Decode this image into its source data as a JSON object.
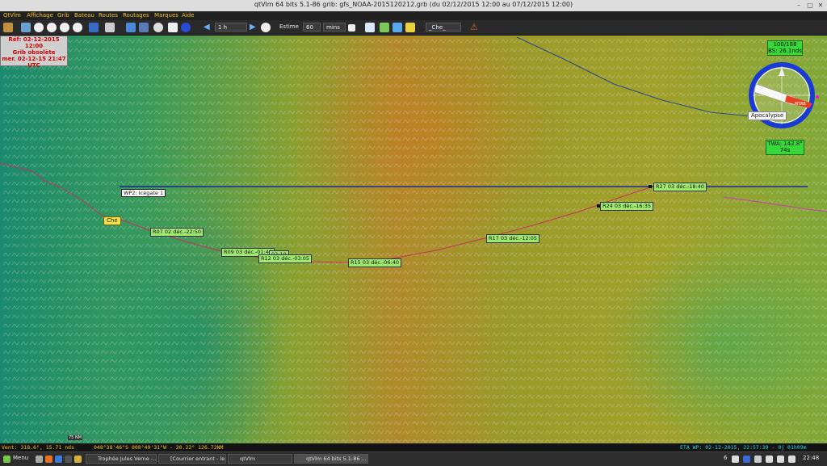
{
  "window": {
    "title": "qtVlm 64 bits 5.1-86 grib: gfs_NOAA-2015120212.grb (du 02/12/2015 12:00 au 07/12/2015 12:00)"
  },
  "menu": [
    "QtVlm",
    "Affichage",
    "Grib",
    "Bateau",
    "Routes",
    "Routages",
    "Marques",
    "Aide"
  ],
  "toolbar": {
    "time_step": "1 h",
    "estime_label": "Estime",
    "estime_value": "60",
    "estime_unit": "mins",
    "boat_select": "_Che_"
  },
  "grib_info": {
    "line1": "Réf: 02-12-2015 12:00",
    "line2": "Grib obsolète",
    "line3": "mer. 02-12-15 21:47",
    "line4": "UTC"
  },
  "waypoint": {
    "label": "WP2: Icegate 1"
  },
  "boat": {
    "label": "Che"
  },
  "route_labels": [
    "R07 02 déc.-22:50",
    "R09 03 déc.-01:40",
    "R12 03 déc.-03:05",
    "R15 03 déc.-06:40",
    "R17 03 déc.-12:05",
    "R24 03 déc.-16:35",
    "R27 03 déc.-18:40"
  ],
  "route_overlap_fragment": "02:10",
  "compass": {
    "count": "100/188",
    "bs": "BS: 26.1nds",
    "route_name": "Apocalypse",
    "vmg_tag": "MTAB",
    "twa": "TWA: 142.8°",
    "twa_sub": "74s"
  },
  "status": {
    "wind": "Vent: 318.6°,  15.71 nds",
    "position": "048°38'46\"S  008°49'31\"W - 20.22°  126.72NM",
    "eta": "ETA WP: 02-12-2015, 22:57:39 - 0j 01h09m"
  },
  "taskbar": {
    "menu": "Menu",
    "tasks": [
      "Trophée Jules Verne -...",
      "[Courrier entrant - le...",
      "qtVlm",
      "qtVlm 64 bits 5.1-86 ..."
    ],
    "clock": "22:48",
    "tray_num": "6"
  },
  "scale_label": "75 NM",
  "colors": {
    "route": "#c83060",
    "wp_line": "#1a2a9a",
    "route_label_bg": "#9fe870",
    "menu_text": "#f0c020",
    "status_yellow": "#f0c020",
    "status_cyan": "#30d0e0"
  }
}
